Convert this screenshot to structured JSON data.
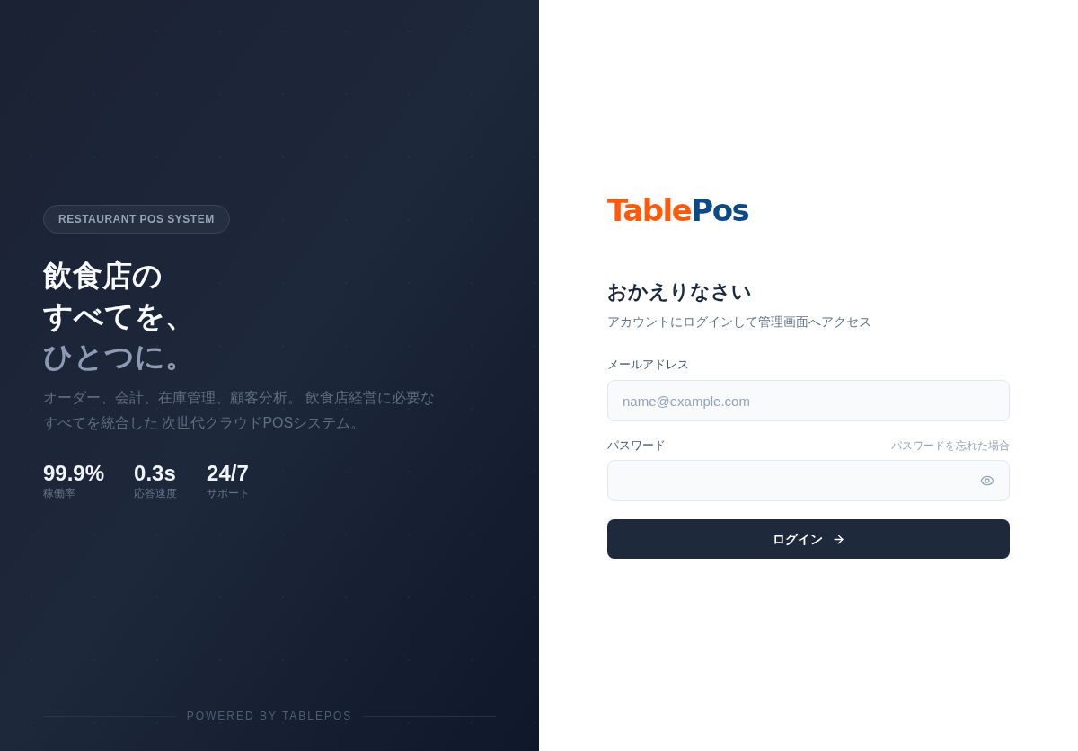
{
  "hero": {
    "badge": "RESTAURANT POS SYSTEM",
    "headline": [
      "飲食店の",
      "すべてを、"
    ],
    "headline_accent": "ひとつに。",
    "description": "オーダー、会計、在庫管理、顧客分析。 飲食店経営に必要なすべてを統合した 次世代クラウドPOSシステム。",
    "stats": [
      {
        "value": "99.9%",
        "label": "稼働率"
      },
      {
        "value": "0.3s",
        "label": "応答速度"
      },
      {
        "value": "24/7",
        "label": "サポート"
      }
    ],
    "footer": "POWERED BY TABLEPOS"
  },
  "login": {
    "logo": [
      "Table",
      "Pos"
    ],
    "title": "おかえりなさい",
    "subtitle": "アカウントにログインして管理画面へアクセス",
    "email": {
      "label": "メールアドレス",
      "placeholder": "name@example.com"
    },
    "password": {
      "label": "パスワード",
      "forgot_link": "パスワードを忘れた場合"
    },
    "submit": "ログイン"
  }
}
